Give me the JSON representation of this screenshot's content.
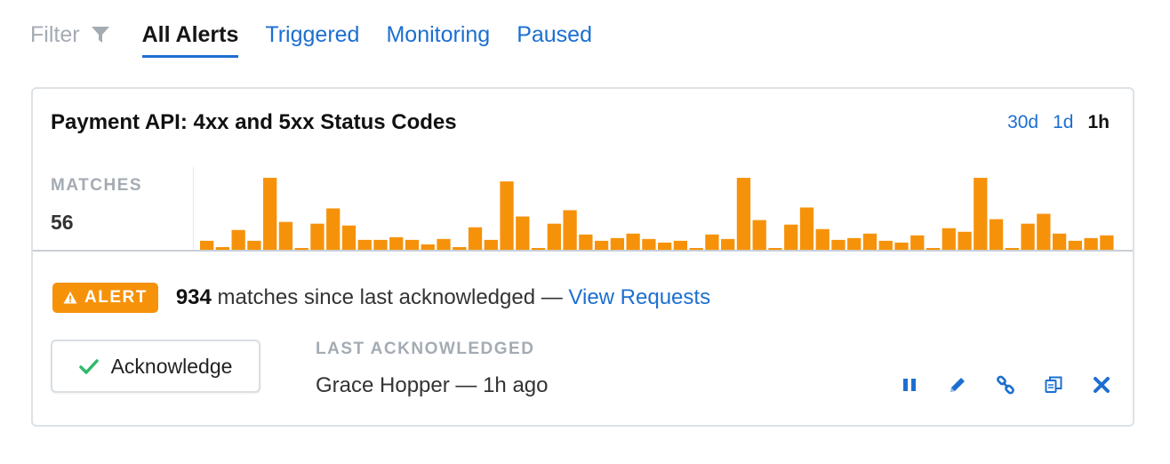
{
  "filter": {
    "label": "Filter",
    "tabs": [
      {
        "label": "All Alerts",
        "active": true
      },
      {
        "label": "Triggered",
        "active": false
      },
      {
        "label": "Monitoring",
        "active": false
      },
      {
        "label": "Paused",
        "active": false
      }
    ]
  },
  "card": {
    "title": "Payment API: 4xx and 5xx Status Codes",
    "ranges": [
      {
        "label": "30d",
        "active": false
      },
      {
        "label": "1d",
        "active": false
      },
      {
        "label": "1h",
        "active": true
      }
    ],
    "metric_label": "MATCHES",
    "metric_value": "56",
    "alert": {
      "badge": "ALERT",
      "count": "934",
      "text": "matches since last acknowledged —",
      "link": "View Requests"
    },
    "acknowledge_label": "Acknowledge",
    "last_ack_label": "LAST ACKNOWLEDGED",
    "last_ack_value": "Grace Hopper — 1h ago",
    "icons": [
      "pause-icon",
      "edit-icon",
      "link-icon",
      "copy-icon",
      "delete-icon"
    ]
  },
  "colors": {
    "accent": "#1c6fd1",
    "bar": "#f6920a",
    "check": "#2dba6a"
  },
  "chart_data": {
    "type": "bar",
    "values": [
      10,
      3,
      22,
      10,
      80,
      31,
      2,
      29,
      46,
      27,
      11,
      11,
      14,
      11,
      6,
      12,
      3,
      25,
      11,
      76,
      37,
      2,
      29,
      44,
      17,
      10,
      13,
      18,
      12,
      8,
      10,
      2,
      17,
      12,
      80,
      33,
      2,
      28,
      47,
      23,
      11,
      13,
      18,
      10,
      8,
      16,
      2,
      24,
      20,
      80,
      34,
      2,
      29,
      40,
      18,
      10,
      13,
      16
    ],
    "title": "",
    "xlabel": "",
    "ylabel": "",
    "ylim": [
      0,
      85
    ],
    "grid": false,
    "legend": "none"
  }
}
